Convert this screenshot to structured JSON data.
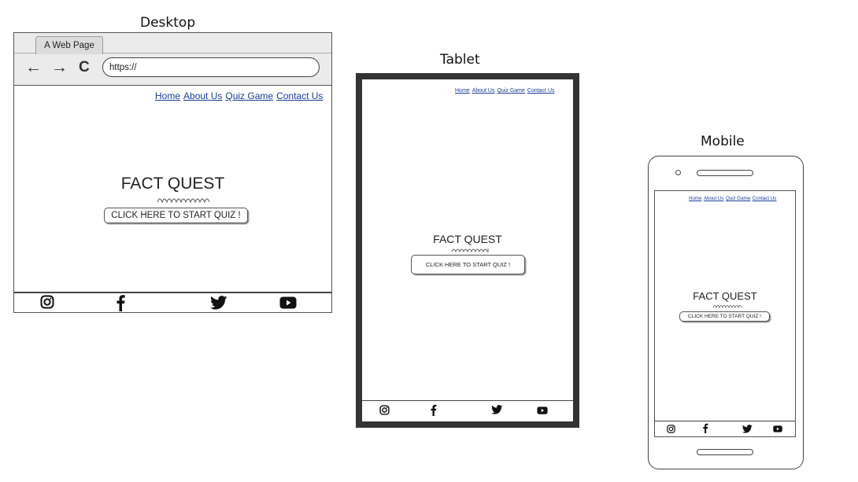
{
  "labels": {
    "desktop": "Desktop",
    "tablet": "Tablet",
    "mobile": "Mobile"
  },
  "browser": {
    "tab_title": "A Web Page",
    "back_glyph": "←",
    "forward_glyph": "→",
    "reload_glyph": "C",
    "url": "https://"
  },
  "nav": {
    "home": "Home",
    "about": "About Us",
    "quiz": "Quiz Game",
    "contact": "Contact Us"
  },
  "hero": {
    "title": "FACT QUEST",
    "button": "CLICK HERE TO START QUIZ !"
  },
  "footer_icons": [
    "instagram-icon",
    "facebook-icon",
    "twitter-icon",
    "youtube-icon"
  ],
  "colors": {
    "link": "#1b3d9c",
    "tablet_frame": "#333333"
  }
}
